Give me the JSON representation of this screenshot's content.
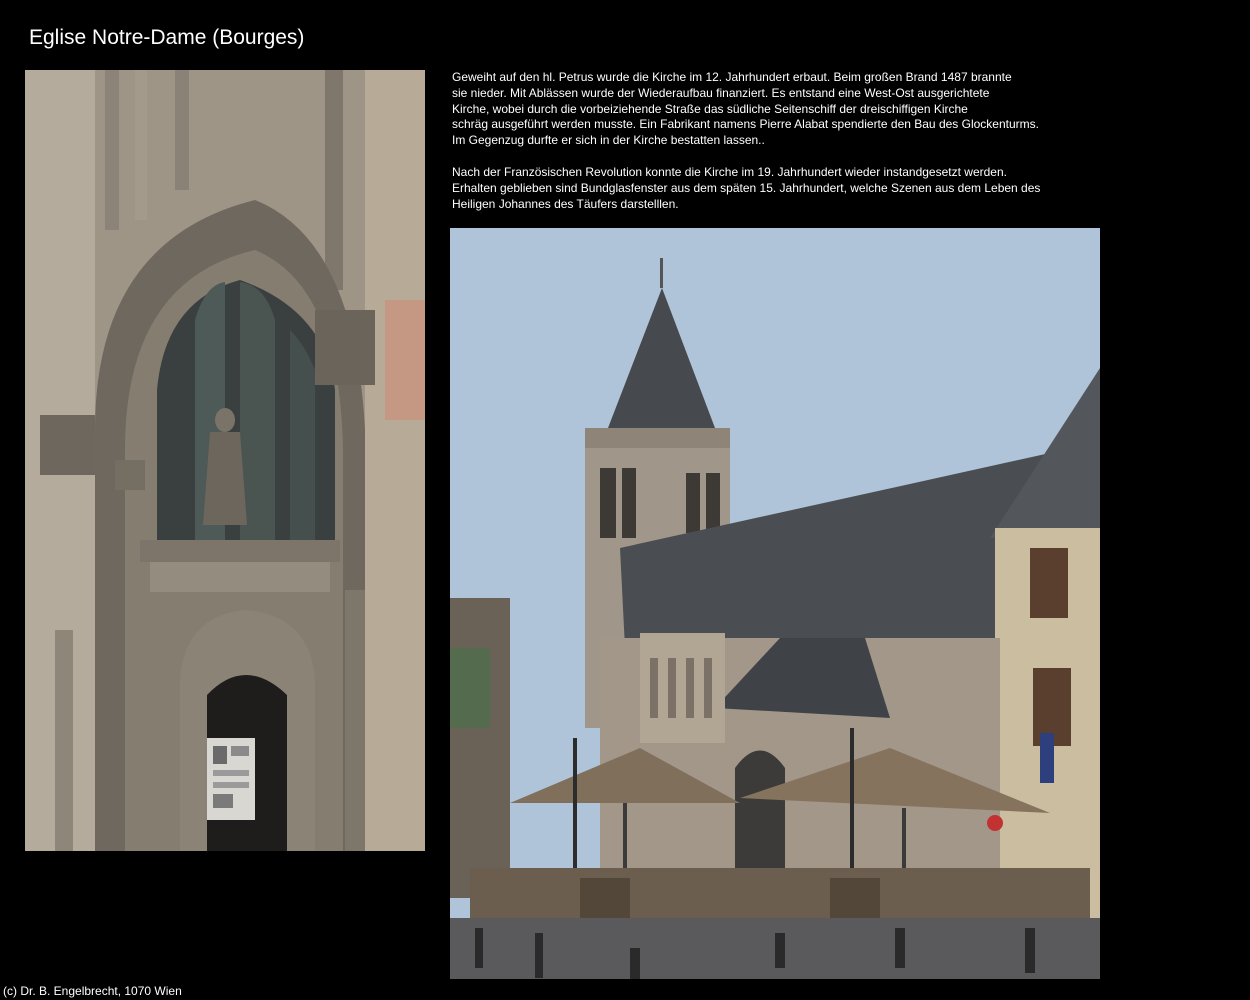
{
  "page": {
    "title": "Eglise Notre-Dame (Bourges)"
  },
  "description": {
    "paragraphs": [
      "Geweiht auf den hl. Petrus wurde die Kirche im 12. Jahrhundert erbaut. Beim großen Brand 1487 brannte\nsie nieder. Mit Ablässen wurde der Wiederaufbau finanziert. Es entstand eine West-Ost ausgerichtete\nKirche, wobei durch die vorbeiziehende Straße das südliche Seitenschiff der dreischiffigen Kirche\nschräg ausgeführt werden musste. Ein Fabrikant namens Pierre Alabat spendierte den Bau des Glockenturms.\nIm Gegenzug durfte er sich in der Kirche bestatten lassen..",
      "Nach der Französischen Revolution konnte die Kirche im 19. Jahrhundert wieder instandgesetzt werden.\nErhalten geblieben sind Bundglasfenster aus dem späten 15. Jahrhundert, welche Szenen aus dem Leben des\nHeiligen Johannes des Täufers darstelllen."
    ]
  },
  "footer": {
    "copyright": "(c) Dr. B. Engelbrecht, 1070 Wien"
  },
  "colors": {
    "background": "#000000",
    "text": "#ffffff",
    "sky": "#b0c4d9",
    "stone": "#a59d90",
    "roof": "#4a4d52"
  }
}
